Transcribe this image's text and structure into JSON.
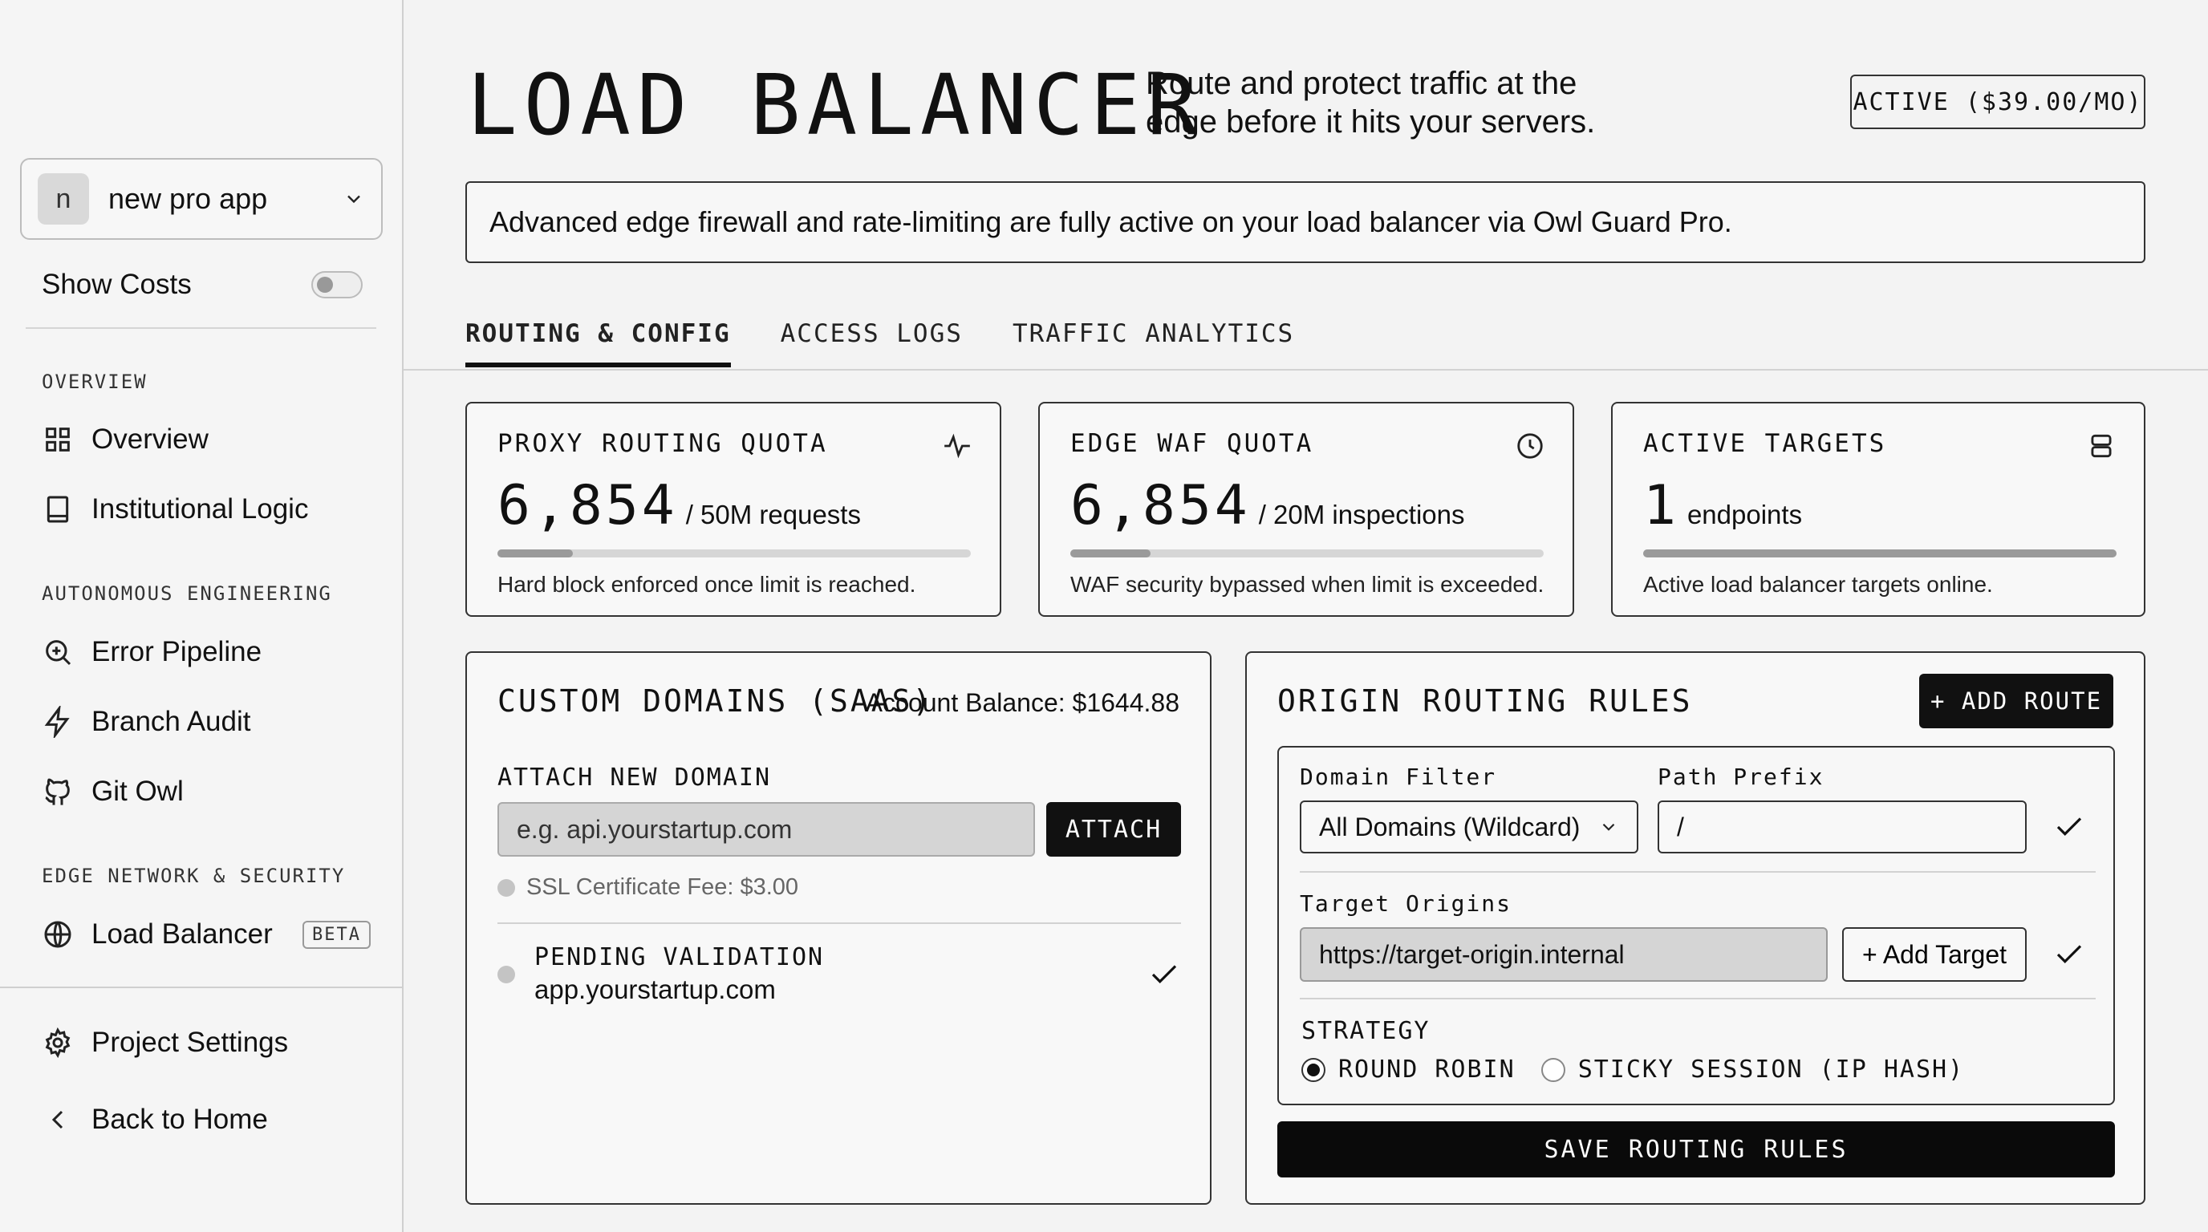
{
  "sidebar": {
    "project": {
      "avatar_letter": "n",
      "name": "new pro app"
    },
    "show_costs": {
      "label": "Show Costs",
      "enabled": false
    },
    "sections": {
      "overview": "OVERVIEW",
      "autonomous": "AUTONOMOUS ENGINEERING",
      "edge": "EDGE NETWORK & SECURITY"
    },
    "items": {
      "overview": "Overview",
      "institutional_logic": "Institutional Logic",
      "error_pipeline": "Error Pipeline",
      "branch_audit": "Branch Audit",
      "git_owl": "Git Owl",
      "load_balancer": "Load Balancer",
      "load_balancer_badge": "BETA",
      "project_settings": "Project Settings",
      "back_home": "Back to Home"
    }
  },
  "header": {
    "title": "LOAD BALANCER",
    "subtitle": "Route and protect traffic at the edge before it hits your servers.",
    "status": "ACTIVE ($39.00/MO)"
  },
  "banner": "Advanced edge firewall and rate-limiting are fully active on your load balancer via Owl Guard Pro.",
  "tabs": [
    "ROUTING & CONFIG",
    "ACCESS LOGS",
    "TRAFFIC ANALYTICS"
  ],
  "stats": [
    {
      "title": "PROXY ROUTING QUOTA",
      "value": "6,854",
      "unit": "/ 50M requests",
      "progress": 0.16,
      "note": "Hard block enforced once limit is reached.",
      "icon": "activity-icon"
    },
    {
      "title": "EDGE WAF QUOTA",
      "value": "6,854",
      "unit": "/ 20M inspections",
      "progress": 0.17,
      "note": "WAF security bypassed when limit is exceeded.",
      "icon": "clock-icon"
    },
    {
      "title": "ACTIVE TARGETS",
      "value": "1",
      "unit": "endpoints",
      "progress": 1.0,
      "note": "Active load balancer targets online.",
      "icon": "server-icon"
    }
  ],
  "domains": {
    "title": "CUSTOM DOMAINS (SAAS)",
    "balance": "Account Balance: $1644.88",
    "attach_label": "ATTACH NEW DOMAIN",
    "input_placeholder": "e.g. api.yourstartup.com",
    "attach_button": "ATTACH",
    "ssl_fee": "SSL Certificate Fee: $3.00",
    "pending_state": "PENDING VALIDATION",
    "pending_domain": "app.yourstartup.com"
  },
  "routing": {
    "title": "ORIGIN ROUTING RULES",
    "add_route": "+ ADD ROUTE",
    "domain_filter_label": "Domain Filter",
    "domain_filter_value": "All Domains (Wildcard)",
    "path_prefix_label": "Path Prefix",
    "path_prefix_value": "/",
    "target_origins_label": "Target Origins",
    "target_origin_value": "https://target-origin.internal",
    "add_target": "+ Add Target",
    "strategy_label": "STRATEGY",
    "strategies": [
      "ROUND ROBIN",
      "STICKY SESSION (IP HASH)"
    ],
    "selected_strategy": "ROUND ROBIN",
    "save_button": "SAVE ROUTING RULES"
  }
}
